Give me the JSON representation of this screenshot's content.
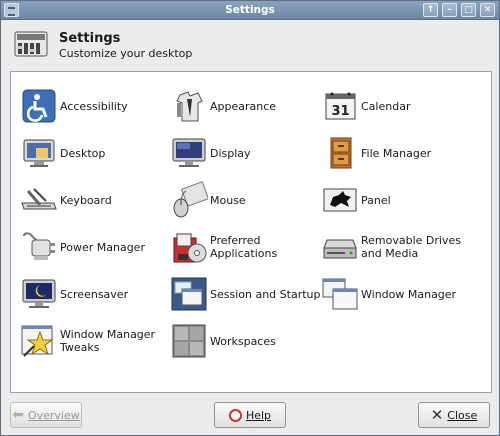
{
  "window": {
    "title": "Settings"
  },
  "header": {
    "title": "Settings",
    "subtitle": "Customize your desktop",
    "icon": "settings-manager-icon"
  },
  "items": [
    {
      "label": "Accessibility",
      "icon": "accessibility-icon"
    },
    {
      "label": "Appearance",
      "icon": "appearance-icon"
    },
    {
      "label": "Calendar",
      "icon": "calendar-icon",
      "day": "31"
    },
    {
      "label": "Desktop",
      "icon": "desktop-icon"
    },
    {
      "label": "Display",
      "icon": "display-icon"
    },
    {
      "label": "File Manager",
      "icon": "file-manager-icon"
    },
    {
      "label": "Keyboard",
      "icon": "keyboard-icon"
    },
    {
      "label": "Mouse",
      "icon": "mouse-icon"
    },
    {
      "label": "Panel",
      "icon": "panel-icon"
    },
    {
      "label": "Power Manager",
      "icon": "power-manager-icon"
    },
    {
      "label": "Preferred Applications",
      "icon": "preferred-applications-icon"
    },
    {
      "label": "Removable Drives and Media",
      "icon": "removable-drives-icon"
    },
    {
      "label": "Screensaver",
      "icon": "screensaver-icon"
    },
    {
      "label": "Session and Startup",
      "icon": "session-startup-icon"
    },
    {
      "label": "Window Manager",
      "icon": "window-manager-icon"
    },
    {
      "label": "Window Manager Tweaks",
      "icon": "window-manager-tweaks-icon"
    },
    {
      "label": "Workspaces",
      "icon": "workspaces-icon"
    }
  ],
  "buttons": {
    "overview": {
      "label": "Overview",
      "enabled": false
    },
    "help": {
      "label": "Help"
    },
    "close": {
      "label": "Close"
    }
  }
}
